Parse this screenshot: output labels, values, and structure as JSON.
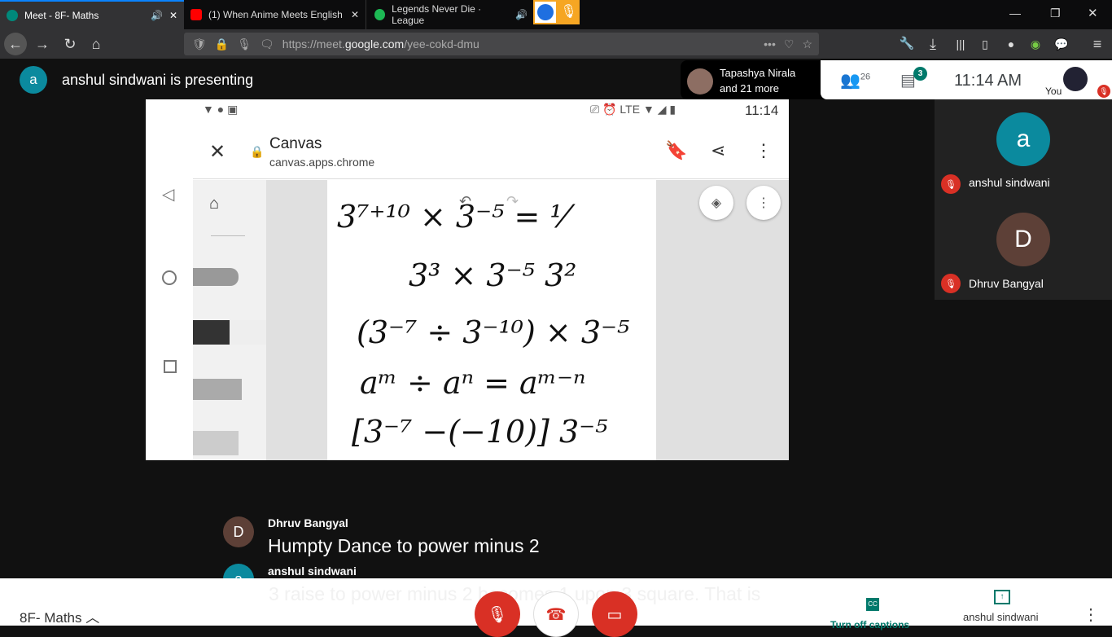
{
  "browser": {
    "tabs": [
      {
        "title": "Meet - 8F- Maths",
        "icon": "google-meet-icon"
      },
      {
        "title": "(1) When Anime Meets English",
        "icon": "youtube-icon"
      },
      {
        "title": "Legends Never Die · League",
        "icon": "spotify-icon"
      }
    ],
    "url_prefix": "https://meet.",
    "url_domain": "google.com",
    "url_path": "/yee-cokd-dmu"
  },
  "meet": {
    "presenting_initial": "a",
    "presenting_text": "anshul sindwani is presenting",
    "participants_summary_1": "Tapashya Nirala",
    "participants_summary_2": "and 21 more",
    "people_count": "26",
    "chat_badge": "3",
    "time": "11:14  AM",
    "you_label": "You",
    "tiles": [
      {
        "initial": "a",
        "name": "anshul sindwani",
        "color": "#0b8a9e"
      },
      {
        "initial": "D",
        "name": "Dhruv Bangyal",
        "color": "#5d4037"
      }
    ],
    "captions": [
      {
        "initial": "D",
        "name": "Dhruv Bangyal",
        "text": "Humpty Dance to power minus 2"
      },
      {
        "initial": "a",
        "name": "anshul sindwani",
        "text": "3 raise to power minus 2 becomes 1 upon 3 square. That is"
      }
    ],
    "meeting_name": "8F- Maths",
    "captions_label": "Turn off captions",
    "presenter_label": "anshul sindwani"
  },
  "phone": {
    "status_time": "11:14",
    "lte": "LTE",
    "app_title": "Canvas",
    "app_url": "canvas.apps.chrome",
    "handwriting": [
      "3⁷⁺¹⁰ × 3⁻⁵ = ⅟",
      "3³ × 3⁻⁵ 3²",
      "(3⁻⁷ ÷ 3⁻¹⁰) × 3⁻⁵",
      "aᵐ ÷ aⁿ = aᵐ⁻ⁿ",
      "[3⁻⁷ −(−10)] 3⁻⁵"
    ]
  }
}
